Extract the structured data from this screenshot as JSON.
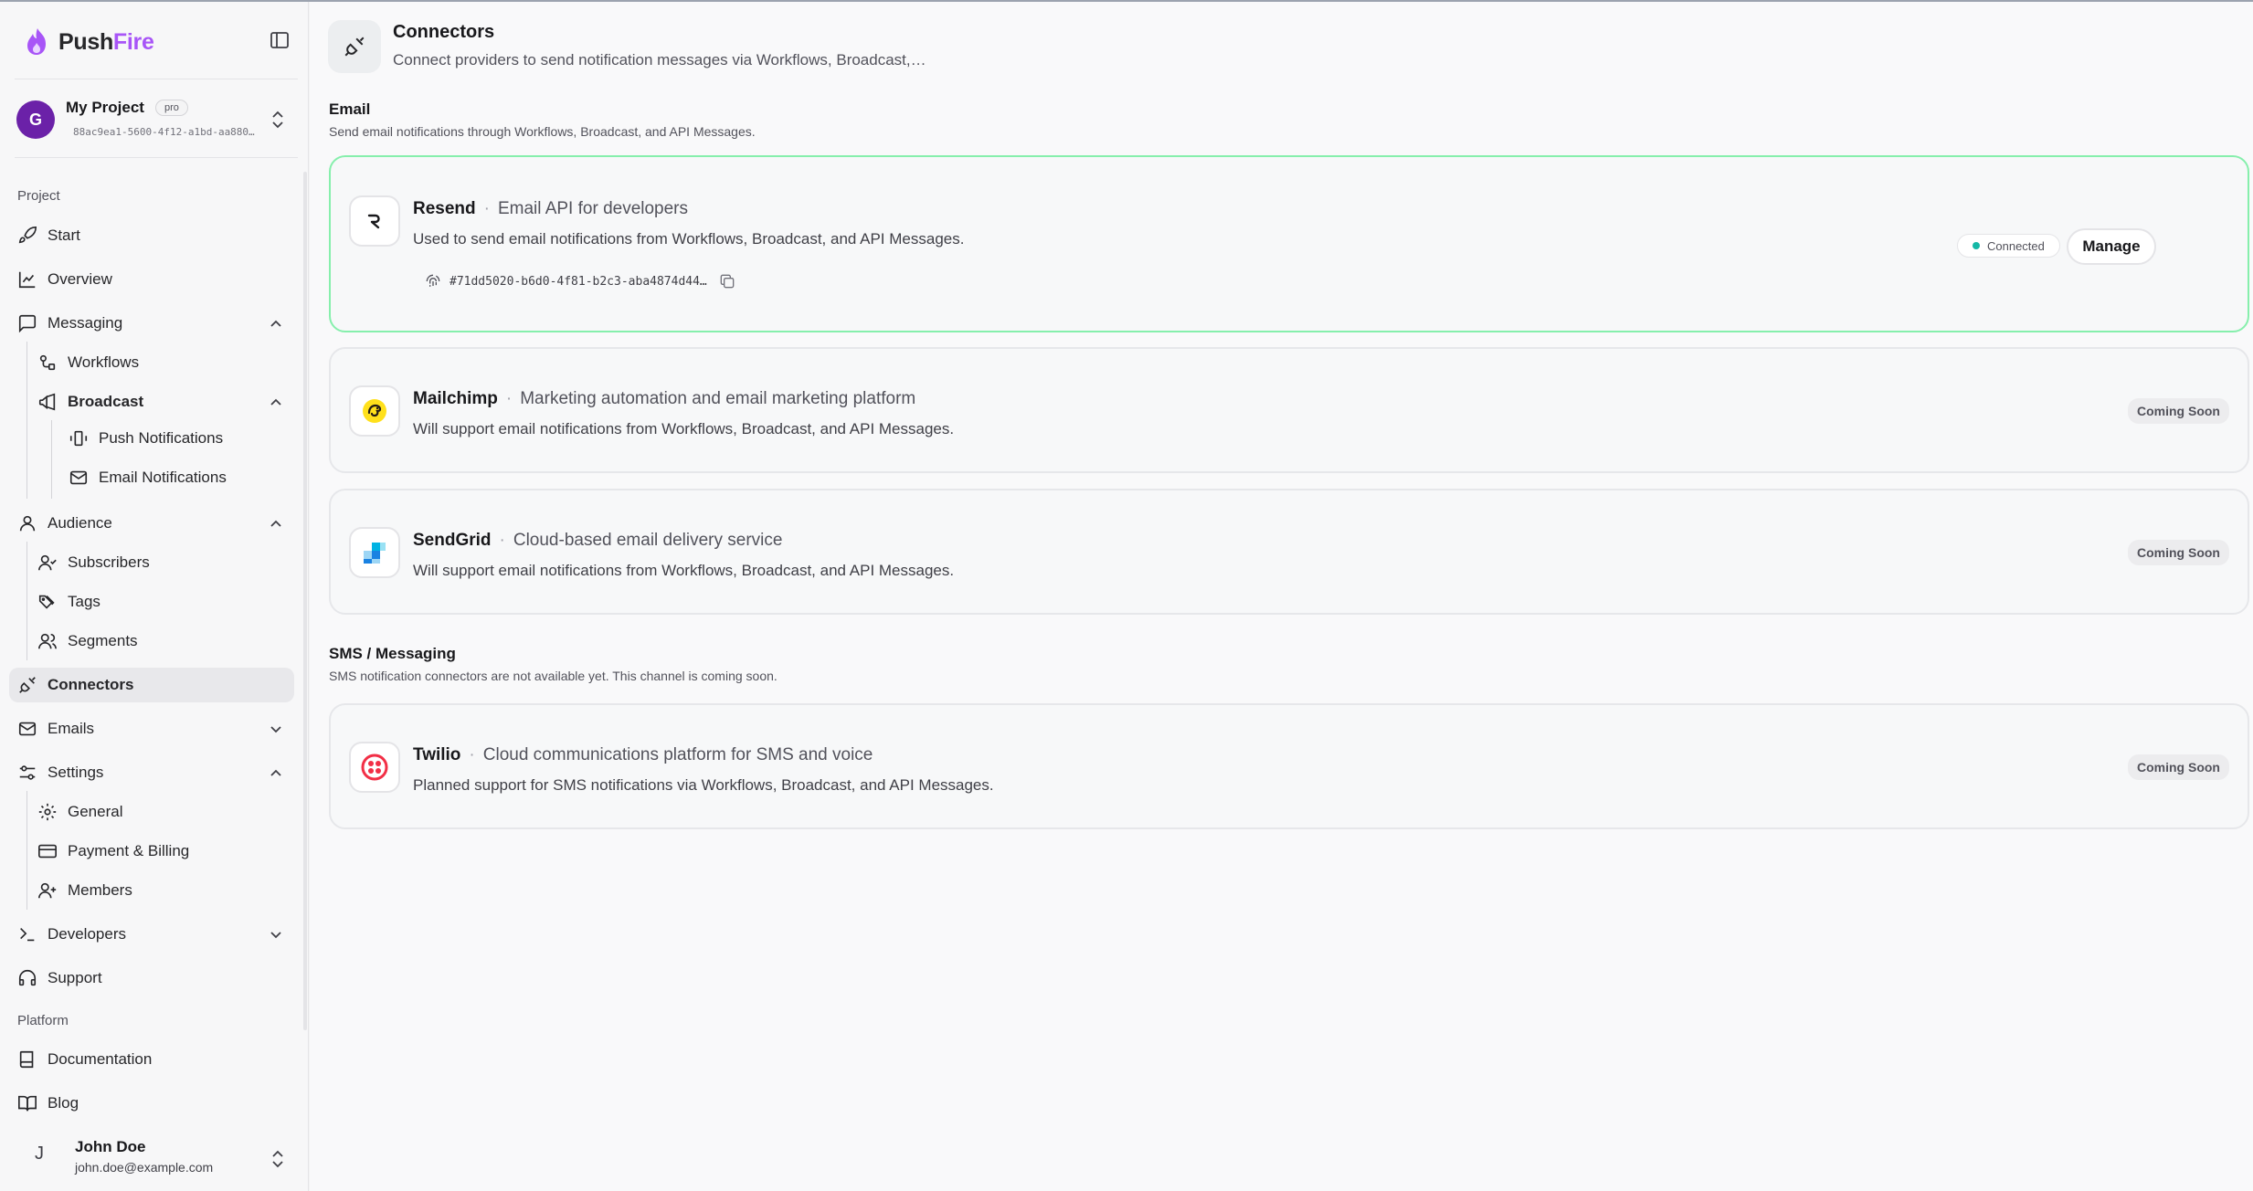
{
  "brand": {
    "name_part1": "Push",
    "name_part2": "Fire"
  },
  "project": {
    "avatar": "G",
    "name": "My Project",
    "plan": "pro",
    "id": "88ac9ea1-5600-4f12-a1bd-aa880…"
  },
  "sidebar": {
    "section_project": "Project",
    "section_platform": "Platform",
    "start": "Start",
    "overview": "Overview",
    "messaging": "Messaging",
    "workflows": "Workflows",
    "broadcast": "Broadcast",
    "push_notifications": "Push Notifications",
    "email_notifications": "Email Notifications",
    "audience": "Audience",
    "subscribers": "Subscribers",
    "tags": "Tags",
    "segments": "Segments",
    "connectors": "Connectors",
    "emails": "Emails",
    "settings": "Settings",
    "general": "General",
    "payment_billing": "Payment & Billing",
    "members": "Members",
    "developers": "Developers",
    "support": "Support",
    "documentation": "Documentation",
    "blog": "Blog"
  },
  "user": {
    "initial": "J",
    "name": "John Doe",
    "email": "john.doe@example.com"
  },
  "header": {
    "title": "Connectors",
    "subtitle": "Connect providers to send notification messages via Workflows, Broadcast,…"
  },
  "sections": {
    "email": {
      "title": "Email",
      "subtitle": "Send email notifications through Workflows, Broadcast, and API Messages."
    },
    "sms": {
      "title": "SMS / Messaging",
      "subtitle": "SMS notification connectors are not available yet. This channel is coming soon."
    }
  },
  "connectors": {
    "resend": {
      "name": "Resend",
      "tagline": "Email API for developers",
      "description": "Used to send email notifications from Workflows, Broadcast, and API Messages.",
      "key": "#71dd5020-b6d0-4f81-b2c3-aba4874d44…",
      "status": "Connected",
      "action": "Manage"
    },
    "mailchimp": {
      "name": "Mailchimp",
      "tagline": "Marketing automation and email marketing platform",
      "description": "Will support email notifications from Workflows, Broadcast, and API Messages.",
      "status": "Coming Soon"
    },
    "sendgrid": {
      "name": "SendGrid",
      "tagline": "Cloud-based email delivery service",
      "description": "Will support email notifications from Workflows, Broadcast, and API Messages.",
      "status": "Coming Soon"
    },
    "twilio": {
      "name": "Twilio",
      "tagline": "Cloud communications platform for SMS and voice",
      "description": "Planned support for SMS notifications via Workflows, Broadcast, and API Messages.",
      "status": "Coming Soon"
    }
  },
  "colors": {
    "brand_accent": "#a855f7",
    "avatar": "#6b21a8",
    "connected_border": "#86efac",
    "connected_dot": "#14b8a6",
    "mailchimp": "#ffe01b",
    "sendgrid": "#1a82e2",
    "twilio": "#f22f46"
  },
  "icons": {
    "brand": "flame-icon",
    "collapse": "sidebar-toggle-icon",
    "connectors_header": "plug-icon",
    "copy": "copy-icon",
    "fingerprint": "fingerprint-icon"
  }
}
